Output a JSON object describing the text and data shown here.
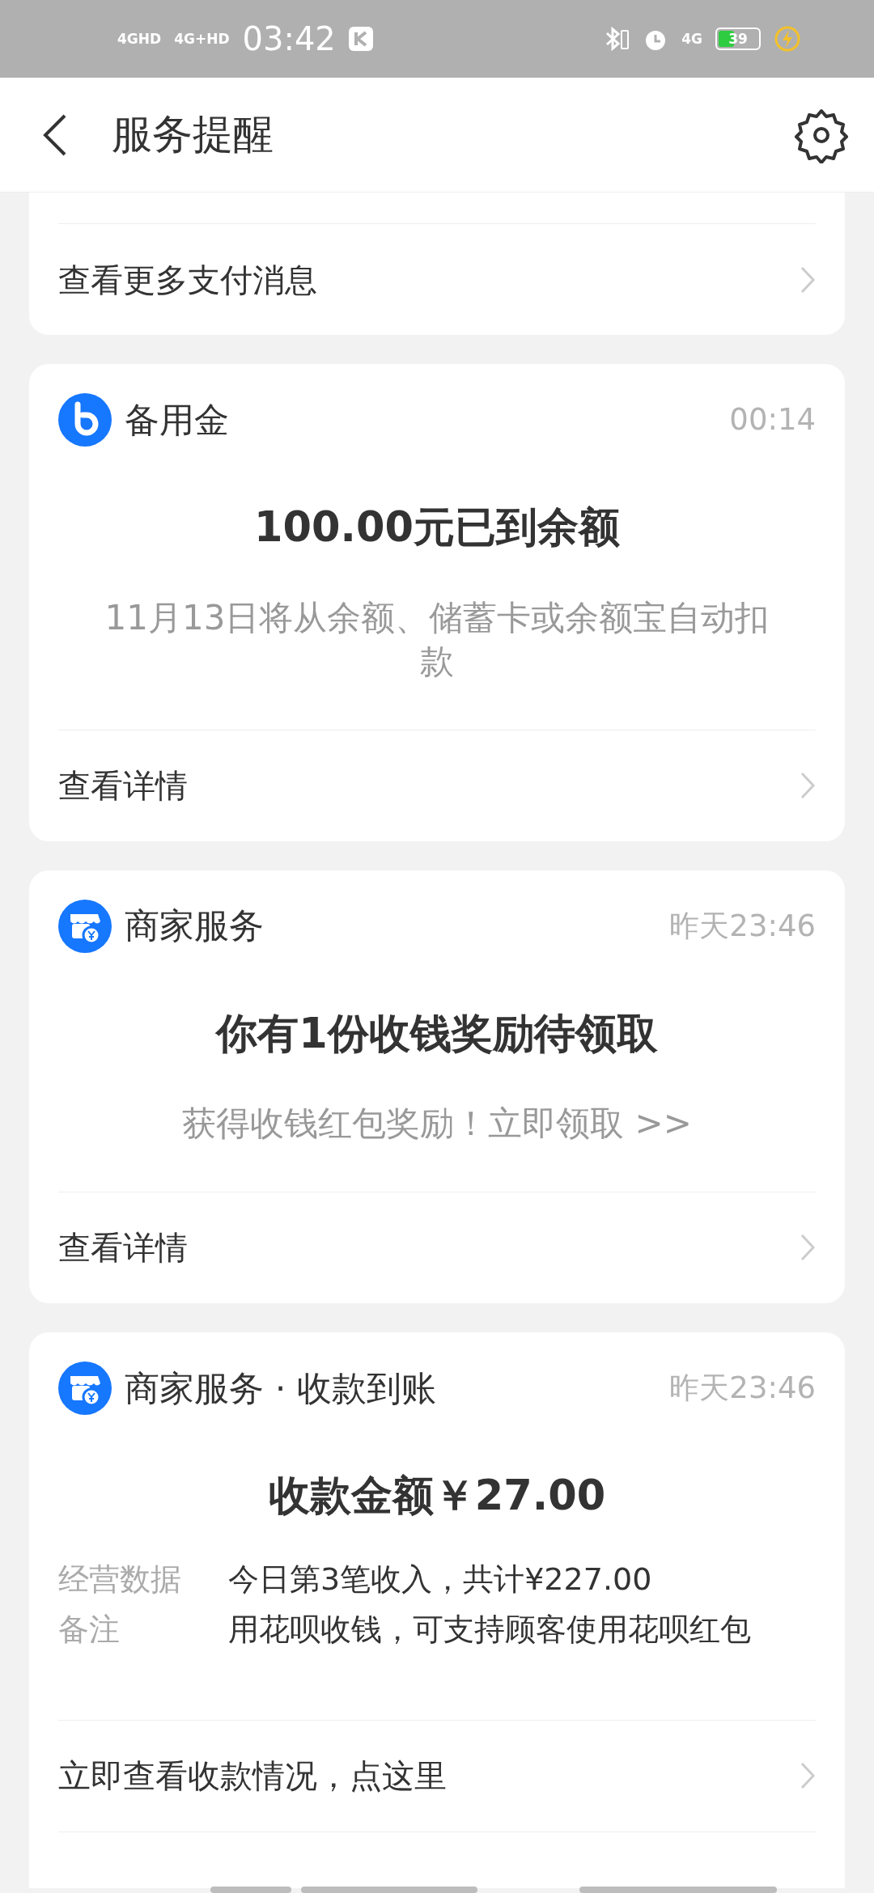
{
  "status_bar": {
    "networks": [
      "4GHD",
      "4G+HD"
    ],
    "time": "03:42",
    "data_network": "4G",
    "battery": "39"
  },
  "header": {
    "title": "服务提醒"
  },
  "cards": [
    {
      "kind": "link_only",
      "links": [
        "查看更多支付消息"
      ]
    },
    {
      "kind": "fund_message",
      "app": "备用金",
      "time": "00:14",
      "headline": "100.00元已到余额",
      "subtitle": "11月13日将从余额、储蓄卡或余额宝自动扣款",
      "links": [
        "查看详情"
      ]
    },
    {
      "kind": "merchant_message",
      "app": "商家服务",
      "time": "昨天23:46",
      "headline": "你有1份收钱奖励待领取",
      "subtitle": "获得收钱红包奖励！立即领取 >>",
      "links": [
        "查看详情"
      ]
    },
    {
      "kind": "merchant_message",
      "app": "商家服务 · 收款到账",
      "time": "昨天23:46",
      "headline": "收款金额￥27.00",
      "details": [
        {
          "label": "经营数据",
          "value": "今日第3笔收入，共计¥227.00"
        },
        {
          "label": "备注",
          "value": "用花呗收钱，可支持顾客使用花呗红包"
        }
      ],
      "links": [
        "立即查看收款情况，点这里"
      ]
    }
  ]
}
